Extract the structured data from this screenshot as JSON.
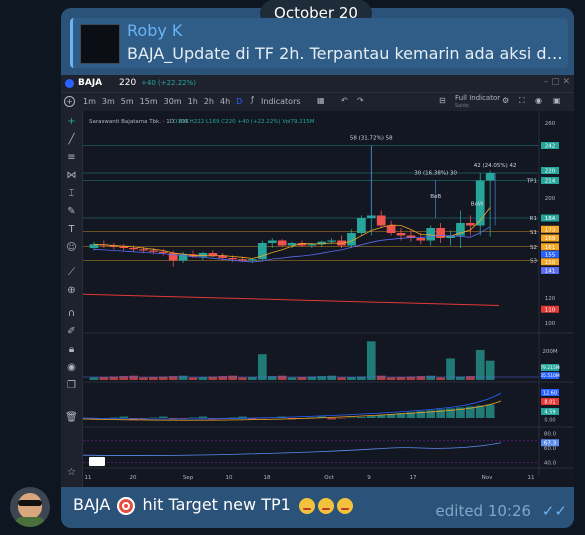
{
  "date_pill": "October 20",
  "reply": {
    "name": "Roby K",
    "text": "BAJA_Update di TF 2h. Terpantau kemarin ada aksi dom..."
  },
  "chart": {
    "symbol": "BAJA",
    "price": "220",
    "change": "+40 (+22.22%)",
    "timeframes": [
      "1m",
      "3m",
      "5m",
      "15m",
      "30m",
      "1h",
      "2h",
      "4h",
      "D"
    ],
    "indicators_label": "Indicators",
    "full_indicator_label": "Full Indicator",
    "full_indicator_sub": "Saldo",
    "legend": "Saraswanti Bajatama Tbk. · 1D · IDX",
    "ohlc": {
      "o": "O180",
      "h": "H222",
      "l": "L169",
      "c": "C220",
      "chg": "+40 (+22.22%)",
      "vol": "Vol79.215M"
    },
    "annotations": [
      {
        "text": "58 (31.72%) 58"
      },
      {
        "text": "30 (16.38%) 30"
      },
      {
        "text": "42 (24.05%) 42"
      },
      {
        "text": "BoB"
      },
      {
        "text": "BoW"
      },
      {
        "text": "TP1"
      },
      {
        "text": "R1"
      },
      {
        "text": "S1"
      },
      {
        "text": "S2"
      },
      {
        "text": "S3"
      }
    ],
    "price_axis": [
      "260",
      "242",
      "220",
      "214",
      "200",
      "184",
      "173",
      "169",
      "161",
      "155",
      "150",
      "141",
      "120",
      "110",
      "100"
    ],
    "volume_axis": [
      "200M",
      "79.215M",
      "35.510M"
    ],
    "osc_axis": [
      "12.60",
      "8.01",
      "4.59",
      "0.00"
    ],
    "rsi_axis": [
      "80.0",
      "67.3",
      "60.0",
      "40.0"
    ],
    "time_axis": [
      "11",
      "20",
      "Sep",
      "10",
      "18",
      "Oct",
      "9",
      "17",
      "Nov",
      "11"
    ],
    "accent": "#26a69a",
    "down": "#ef5350"
  },
  "message": {
    "sender": "BAJA",
    "text": "hit Target new TP1",
    "edited": "edited 10:26"
  }
}
